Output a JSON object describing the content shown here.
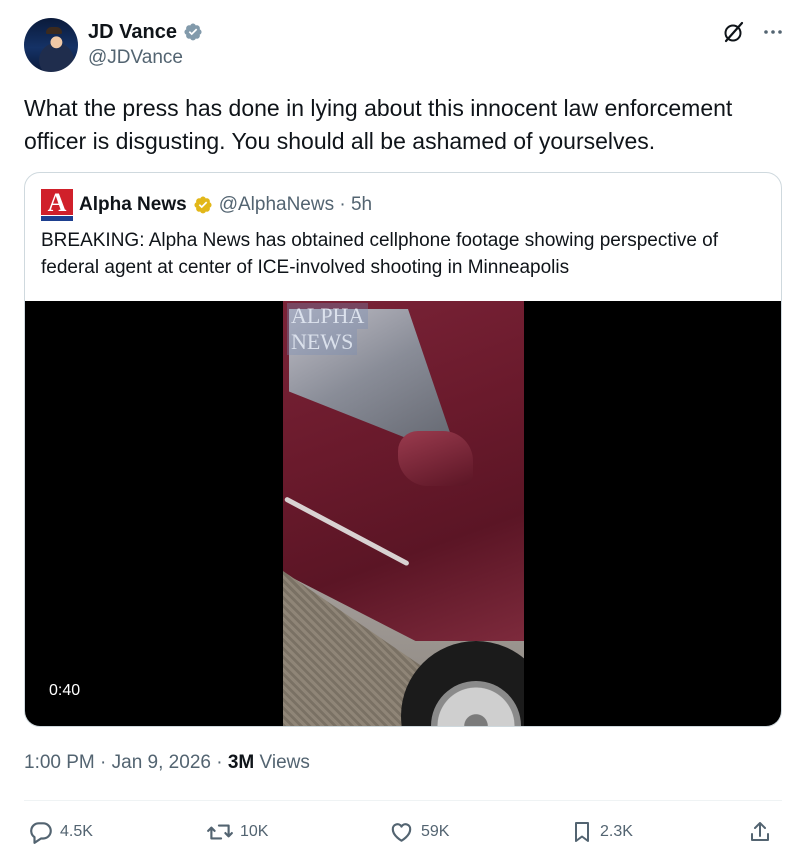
{
  "author": {
    "display_name": "JD Vance",
    "handle": "@JDVance"
  },
  "icons": {
    "verified": "verified-badge-icon",
    "grok": "grok-icon",
    "more": "more-icon",
    "reply": "reply-icon",
    "repost": "repost-icon",
    "like": "like-icon",
    "bookmark": "bookmark-icon",
    "share": "share-icon"
  },
  "colors": {
    "verified_blue": "#829aab",
    "verified_gold": "#e2b719",
    "secondary_text": "#536471",
    "border": "#cfd9de",
    "alpha_red": "#d0202a",
    "alpha_blue": "#1d3f8f"
  },
  "tweet": {
    "text": "What the press has done in lying about this innocent law enforcement officer is disgusting. You should all be ashamed of yourselves."
  },
  "quote": {
    "logo_letter": "A",
    "display_name": "Alpha News",
    "handle_time": "@AlphaNews · 5h",
    "text": "BREAKING: Alpha News has obtained cellphone footage showing perspective of federal agent at center of ICE-involved shooting in Minneapolis",
    "video": {
      "duration": "0:40",
      "watermark_line1": "ALPHA",
      "watermark_line2": "NEWS"
    }
  },
  "meta": {
    "timestamp": "1:00 PM · Jan 9, 2026 · ",
    "views_count": "3M",
    "views_label": " Views"
  },
  "actions": {
    "replies": "4.5K",
    "reposts": "10K",
    "likes": "59K",
    "bookmarks": "2.3K"
  }
}
